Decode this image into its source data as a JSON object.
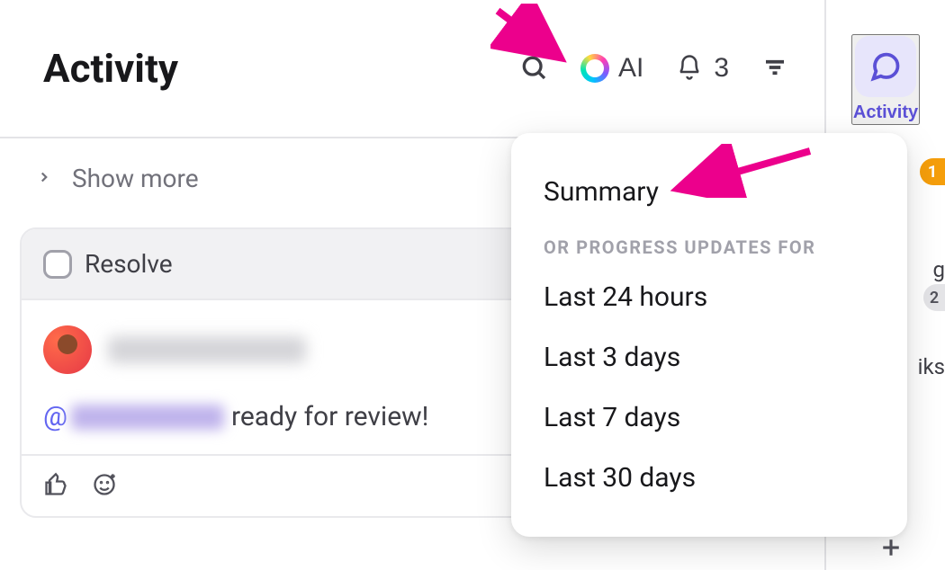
{
  "header": {
    "title": "Activity",
    "ai_label": "AI",
    "notification_count": "3"
  },
  "show_more": "Show more",
  "comment_card": {
    "resolve_label": "Resolve",
    "assignee_partial": "As",
    "mention_prefix": "@",
    "comment_text_after": " ready for review!"
  },
  "right_rail": {
    "activity_label": "Activity",
    "badge1": "1",
    "peek_g": "g",
    "badge2": "2",
    "peek_iks": "iks"
  },
  "dropdown": {
    "summary": "Summary",
    "section_label": "OR PROGRESS UPDATES FOR",
    "options": [
      "Last 24 hours",
      "Last 3 days",
      "Last 7 days",
      "Last 30 days"
    ]
  }
}
